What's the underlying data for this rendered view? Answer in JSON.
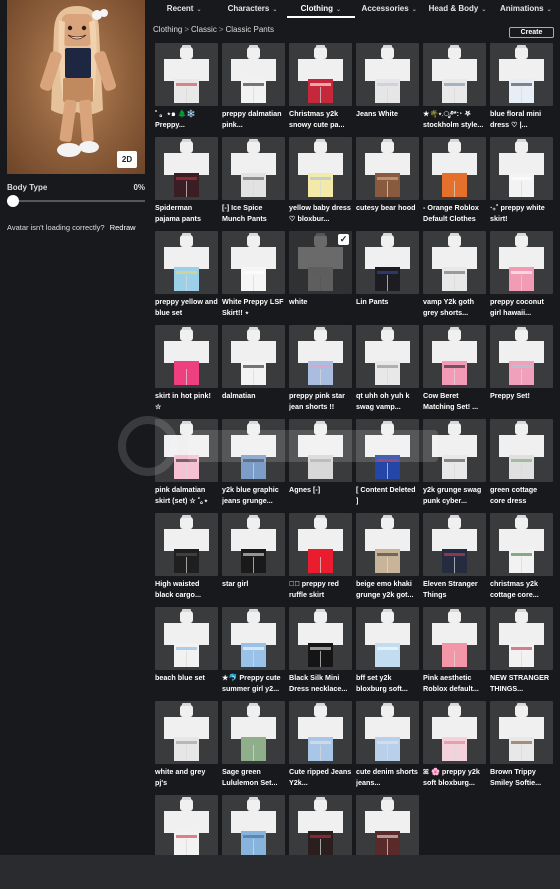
{
  "tabs": [
    {
      "label": "Recent"
    },
    {
      "label": "Characters"
    },
    {
      "label": "Clothing"
    },
    {
      "label": "Accessories"
    },
    {
      "label": "Head & Body"
    },
    {
      "label": "Animations"
    }
  ],
  "active_tab": "Clothing",
  "breadcrumb": [
    "Clothing",
    "Classic",
    "Classic Pants"
  ],
  "create_label": "Create",
  "avatar": {
    "view_toggle": "2D"
  },
  "body_type": {
    "label": "Body Type",
    "value": "0%",
    "level": 0
  },
  "loading": {
    "text": "Avatar isn't loading correctly?",
    "link": "Redraw"
  },
  "items": [
    {
      "name": "˚ 。⋆๑ 🌲❄️ Preppy...",
      "pants": "#e8e8e8",
      "accent": "#d33a4b"
    },
    {
      "name": "preppy dalmatian pink...",
      "pants": "#f2f2f2",
      "accent": "#222222"
    },
    {
      "name": "Christmas y2k snowy cute pa...",
      "pants": "#c4283a",
      "accent": "#ffffff"
    },
    {
      "name": "Jeans White",
      "pants": "#e6e6e6",
      "accent": "#bfc8d6"
    },
    {
      "name": "★🌴⋆.ೃ࿔*:･ 𖤐 stockholm style...",
      "pants": "#e9e9e9",
      "accent": "#7a8ca6"
    },
    {
      "name": "blue floral mini dress ♡ |...",
      "pants": "#e8eef8",
      "accent": "#3a3a3a"
    },
    {
      "name": "Spiderman pajama pants",
      "pants": "#3b1d24",
      "accent": "#c03040"
    },
    {
      "name": "[-] Ice Spice Munch Pants",
      "pants": "#e2e2e2",
      "accent": "#555555"
    },
    {
      "name": "yellow baby dress ♡ bloxbur...",
      "pants": "#f3e9a8",
      "accent": "#9cc0e8"
    },
    {
      "name": "cutesy bear hood",
      "pants": "#8a5a3e",
      "accent": "#d8b49a"
    },
    {
      "name": "- Orange Roblox Default Clothes",
      "pants": "#e4702c",
      "accent": "#e4702c"
    },
    {
      "name": "‧₊˚ preppy white skirt!",
      "pants": "#f3f3f3",
      "accent": "#ffffff"
    },
    {
      "name": "preppy yellow and blue set",
      "pants": "#9bd0e8",
      "accent": "#f0d860"
    },
    {
      "name": "White Preppy LSF Skirt!! ⋆",
      "pants": "#f6f6f6",
      "accent": "#ffffff"
    },
    {
      "name": "white",
      "pants": "#5e5e5e",
      "accent": "#5e5e5e"
    },
    {
      "name": "Lin Pants",
      "pants": "#1c1c22",
      "accent": "#3a4a9a"
    },
    {
      "name": "vamp Y2k goth grey shorts...",
      "pants": "#e8e8e8",
      "accent": "#666666"
    },
    {
      "name": "preppy coconut girl hawaii...",
      "pants": "#f29bb4",
      "accent": "#ffffff"
    },
    {
      "name": "skirt in hot pink! ☆",
      "pants": "#ee3f7e",
      "accent": "#ee3f7e"
    },
    {
      "name": "dalmatian",
      "pants": "#f3f3f3",
      "accent": "#222222"
    },
    {
      "name": "preppy pink star jean shorts !!",
      "pants": "#a9bde0",
      "accent": "#f39ac0"
    },
    {
      "name": "qt uhh oh yuh k swag vamp...",
      "pants": "#e8e8e8",
      "accent": "#888888"
    },
    {
      "name": "Cow Beret Matching Set! ...",
      "pants": "#f29ab6",
      "accent": "#222222"
    },
    {
      "name": "Preppy Set!",
      "pants": "#f1a0bb",
      "accent": "#8fd6e0"
    },
    {
      "name": "pink dalmatian skirt (set) ☆ ˚｡⋆",
      "pants": "#f6c1d3",
      "accent": "#222222"
    },
    {
      "name": "y2k blue graphic jeans grunge...",
      "pants": "#7d9dc9",
      "accent": "#2a2a2a"
    },
    {
      "name": "Agnes [-]",
      "pants": "#d8d8d8",
      "accent": "#999999"
    },
    {
      "name": "[ Content Deleted ]",
      "pants": "#2446a8",
      "accent": "#c8202a"
    },
    {
      "name": "y2k grunge swag punk cyber...",
      "pants": "#e8e8e8",
      "accent": "#444444"
    },
    {
      "name": "green cottage core dress",
      "pants": "#e0e0e0",
      "accent": "#7aa36f"
    },
    {
      "name": "High waisted black cargo...",
      "pants": "#1f1f1f",
      "accent": "#555555"
    },
    {
      "name": "star girl",
      "pants": "#1a1a1a",
      "accent": "#e8e8e8"
    },
    {
      "name": "☆ﾟ preppy red ruffle skirt",
      "pants": "#ea1d2e",
      "accent": "#ea1d2e"
    },
    {
      "name": "beige emo khaki grunge y2k got...",
      "pants": "#c7b499",
      "accent": "#333333"
    },
    {
      "name": "Eleven Stranger Things",
      "pants": "#262c40",
      "accent": "#d0405a"
    },
    {
      "name": "christmas y2k cottage core...",
      "pants": "#f2f2f2",
      "accent": "#3a7a3a"
    },
    {
      "name": "beach blue set",
      "pants": "#f2f2f2",
      "accent": "#7fb6e0"
    },
    {
      "name": "★🐬 Preppy cute summer girl y2...",
      "pants": "#9ac1e8",
      "accent": "#ffffff"
    },
    {
      "name": "Black Silk Mini Dress necklace...",
      "pants": "#151515",
      "accent": "#e6e6e6"
    },
    {
      "name": "bff set y2k bloxburg soft...",
      "pants": "#c2ddf0",
      "accent": "#ffffff"
    },
    {
      "name": "Pink aesthetic Roblox default...",
      "pants": "#f296a8",
      "accent": "#f296a8"
    },
    {
      "name": "NEW STRANGER THINGS...",
      "pants": "#f2f2f2",
      "accent": "#c03040"
    },
    {
      "name": "white and grey pj's",
      "pants": "#e6e6e6",
      "accent": "#9a9a9a"
    },
    {
      "name": "Sage green Lululemon Set...",
      "pants": "#8fae8a",
      "accent": "#8fae8a"
    },
    {
      "name": "Cute ripped Jeans Y2k...",
      "pants": "#a9c6e6",
      "accent": "#e6e6e6"
    },
    {
      "name": "cute denim shorts jeans...",
      "pants": "#b8d0ea",
      "accent": "#e6e6e6"
    },
    {
      "name": "ꕤ 🌸 preppy y2k soft bloxburg...",
      "pants": "#f4d2dc",
      "accent": "#d9808f"
    },
    {
      "name": "Brown Trippy Smiley Softie...",
      "pants": "#e8e8e8",
      "accent": "#7a5030"
    },
    {
      "name": "",
      "pants": "#f2f2f2",
      "accent": "#d03040"
    },
    {
      "name": "",
      "pants": "#88b4dc",
      "accent": "#3a6aa0"
    },
    {
      "name": "",
      "pants": "#2b1e1e",
      "accent": "#c03040"
    },
    {
      "name": "",
      "pants": "#5a2a2a",
      "accent": "#e6e6e6"
    }
  ],
  "selected_item": "white"
}
